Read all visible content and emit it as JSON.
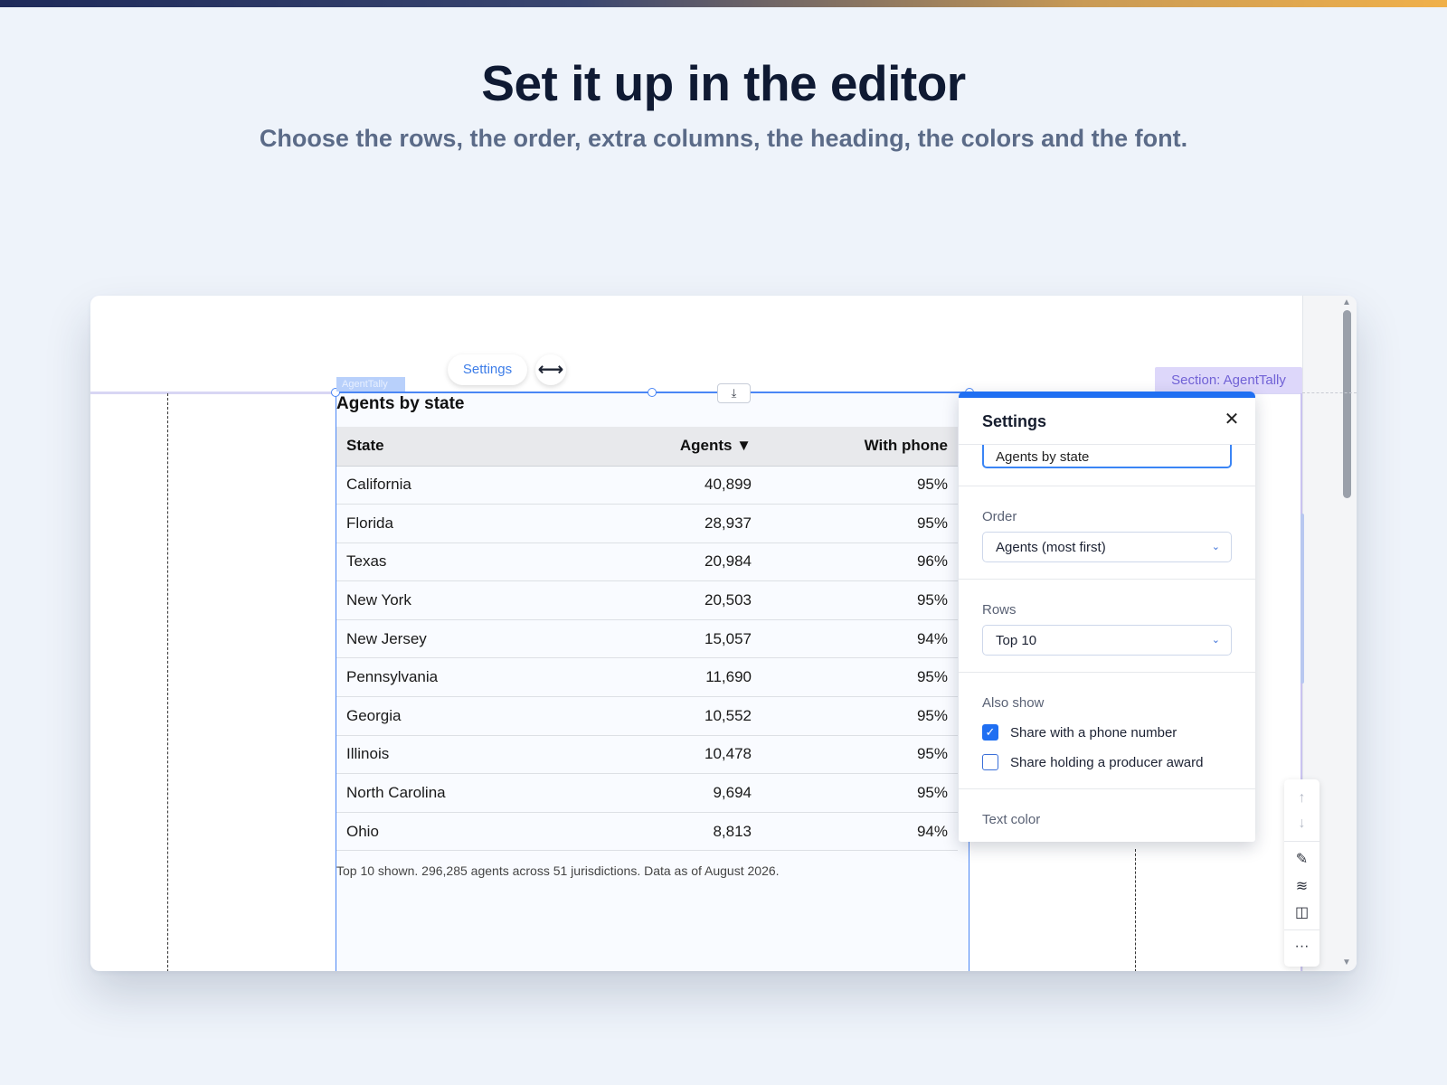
{
  "hero": {
    "title": "Set it up in the editor",
    "subtitle": "Choose the rows, the order, extra columns, the heading, the colors and the font."
  },
  "editor": {
    "section_tag": "Section: AgentTally",
    "widget_name": "AgentTally",
    "settings_chip": "Settings",
    "stretch_icon": "⟷",
    "download_icon": "⤓"
  },
  "widget": {
    "heading": "Agents by state",
    "columns": [
      "State",
      "Agents ▼",
      "With phone"
    ],
    "rows": [
      {
        "state": "California",
        "agents": "40,899",
        "phone": "95%"
      },
      {
        "state": "Florida",
        "agents": "28,937",
        "phone": "95%"
      },
      {
        "state": "Texas",
        "agents": "20,984",
        "phone": "96%"
      },
      {
        "state": "New York",
        "agents": "20,503",
        "phone": "95%"
      },
      {
        "state": "New Jersey",
        "agents": "15,057",
        "phone": "94%"
      },
      {
        "state": "Pennsylvania",
        "agents": "11,690",
        "phone": "95%"
      },
      {
        "state": "Georgia",
        "agents": "10,552",
        "phone": "95%"
      },
      {
        "state": "Illinois",
        "agents": "10,478",
        "phone": "95%"
      },
      {
        "state": "North Carolina",
        "agents": "9,694",
        "phone": "95%"
      },
      {
        "state": "Ohio",
        "agents": "8,813",
        "phone": "94%"
      }
    ],
    "footnote": "Top 10 shown. 296,285 agents across 51 jurisdictions. Data as of August 2026."
  },
  "panel": {
    "title": "Settings",
    "close_icon": "✕",
    "heading_value": "Agents by state",
    "order_label": "Order",
    "order_value": "Agents (most first)",
    "rows_label": "Rows",
    "rows_value": "Top 10",
    "also_show_label": "Also show",
    "options": [
      {
        "label": "Share with a phone number",
        "checked": true
      },
      {
        "label": "Share holding a producer award",
        "checked": false
      }
    ],
    "text_color_label": "Text color"
  },
  "toolbar": {
    "up_icon": "↑",
    "down_icon": "↓",
    "pen_icon": "✎",
    "layers_icon": "≋",
    "layout_icon": "◫",
    "more_icon": "···"
  },
  "colors": {
    "accent": "#1f6ff2",
    "section": "#7162d6",
    "heading": "#0f1a33"
  }
}
